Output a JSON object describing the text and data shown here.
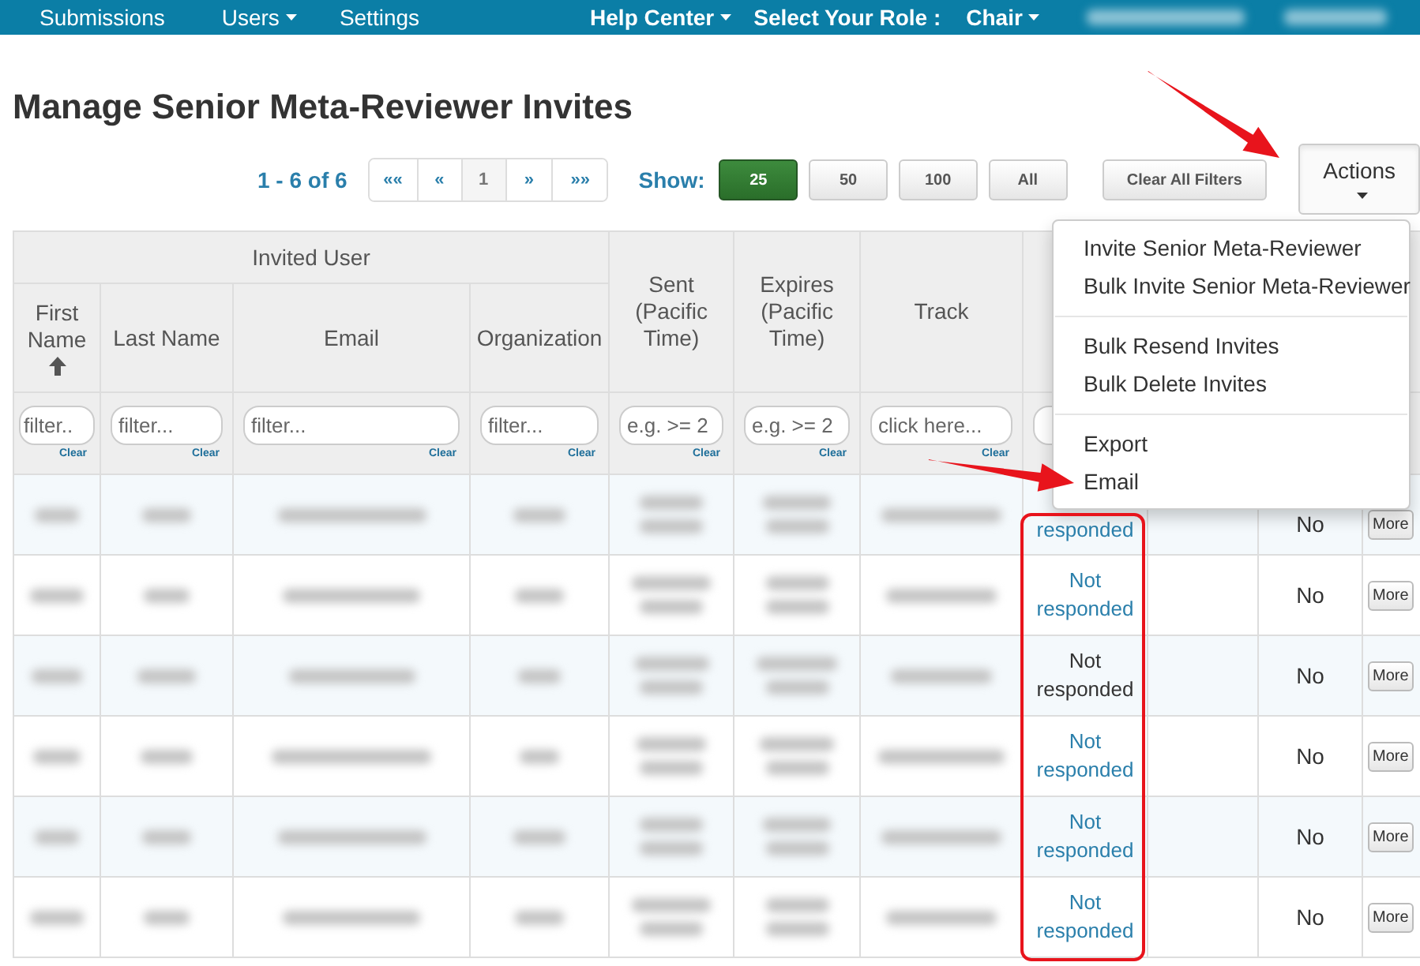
{
  "navbar": {
    "left_items": [
      {
        "label": "Submissions",
        "dropdown": false
      },
      {
        "label": "Users",
        "dropdown": true
      },
      {
        "label": "Settings",
        "dropdown": false
      }
    ],
    "right_items": [
      {
        "label": "Help Center",
        "dropdown": true
      },
      {
        "label": "Select Your Role :",
        "dropdown": false
      },
      {
        "label": "Chair",
        "dropdown": true
      }
    ]
  },
  "page_title": "Manage Senior Meta-Reviewer Invites",
  "pagination": {
    "summary": "1 - 6 of 6",
    "pages": [
      {
        "label": "««",
        "selected": false
      },
      {
        "label": "«",
        "selected": false
      },
      {
        "label": "1",
        "selected": true
      },
      {
        "label": "»",
        "selected": false
      },
      {
        "label": "»»",
        "selected": false
      }
    ]
  },
  "page_size": {
    "label": "Show:",
    "options": [
      {
        "label": "25",
        "selected": true
      },
      {
        "label": "50",
        "selected": false
      },
      {
        "label": "100",
        "selected": false
      },
      {
        "label": "All",
        "selected": false
      }
    ]
  },
  "clear_filters_button": "Clear All Filters",
  "actions_button": {
    "label": "Actions",
    "expanded": true
  },
  "actions_menu": {
    "groups": [
      [
        "Invite Senior Meta-Reviewer",
        "Bulk Invite Senior Meta-Reviewer"
      ],
      [
        "Bulk Resend Invites",
        "Bulk Delete Invites"
      ],
      [
        "Export",
        "Email"
      ]
    ]
  },
  "table": {
    "group_header": "Invited User",
    "columns": [
      {
        "label": "First Name",
        "sorted_ascending": true
      },
      {
        "label": "Last Name",
        "sorted_ascending": false
      },
      {
        "label": "Email",
        "sorted_ascending": false
      },
      {
        "label": "Organization",
        "sorted_ascending": false
      },
      {
        "label": "Sent (Pacific Time)",
        "sorted_ascending": false
      },
      {
        "label": "Expires (Pacific Time)",
        "sorted_ascending": false
      },
      {
        "label": "Track",
        "sorted_ascending": false
      }
    ],
    "filters": [
      {
        "placeholder": "filter..",
        "clear": "Clear"
      },
      {
        "placeholder": "filter...",
        "clear": "Clear"
      },
      {
        "placeholder": "filter...",
        "clear": "Clear"
      },
      {
        "placeholder": "filter...",
        "clear": "Clear"
      },
      {
        "placeholder": "e.g. >= 2",
        "clear": "Clear"
      },
      {
        "placeholder": "e.g. >= 2",
        "clear": "Clear"
      },
      {
        "placeholder": "click here...",
        "clear": "Clear"
      }
    ],
    "rows": [
      {
        "status": "responded",
        "status_link": true,
        "column_10": "No",
        "button": "More"
      },
      {
        "status": "Not responded",
        "status_link": true,
        "column_10": "No",
        "button": "More"
      },
      {
        "status": "Not responded",
        "status_link": false,
        "column_10": "No",
        "button": "More"
      },
      {
        "status": "Not responded",
        "status_link": true,
        "column_10": "No",
        "button": "More"
      },
      {
        "status": "Not responded",
        "status_link": true,
        "column_10": "No",
        "button": "More"
      },
      {
        "status": "Not responded",
        "status_link": true,
        "column_10": "No",
        "button": "More"
      }
    ]
  },
  "annotations": [
    {
      "kind": "arrow"
    },
    {
      "kind": "arrow"
    },
    {
      "kind": "highlight-box"
    }
  ]
}
